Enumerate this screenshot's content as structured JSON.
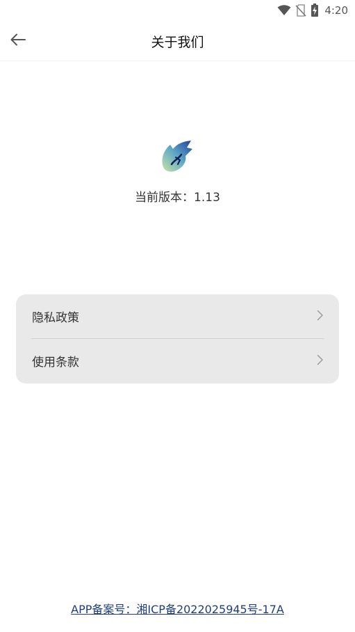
{
  "status_bar": {
    "time": "4:20",
    "icons": [
      "wifi-icon",
      "no-sim-icon",
      "battery-charging-icon"
    ]
  },
  "header": {
    "title": "关于我们",
    "back_icon": "arrow-left-icon"
  },
  "app_info": {
    "logo_icon": "dragon-logo-icon",
    "version_text": "当前版本：1.13"
  },
  "menu": {
    "items": [
      {
        "label": "隐私政策",
        "icon": "chevron-right-icon"
      },
      {
        "label": "使用条款",
        "icon": "chevron-right-icon"
      }
    ]
  },
  "footer": {
    "icp_text": "APP备案号：湘ICP备2022025945号-17A"
  },
  "colors": {
    "card_background": "#e9e9e9",
    "link": "#1f3e7a",
    "text": "#333333"
  }
}
